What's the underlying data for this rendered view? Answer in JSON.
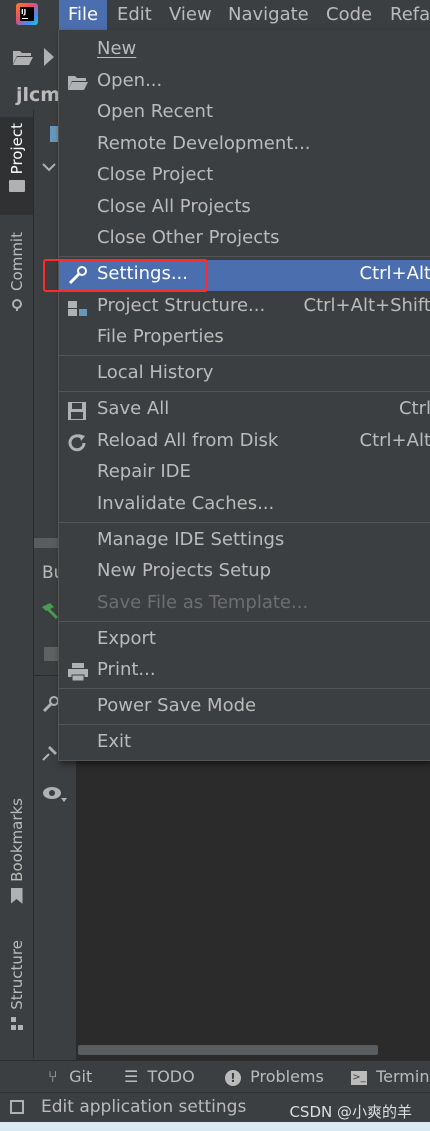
{
  "menubar": {
    "items": [
      "File",
      "Edit",
      "View",
      "Navigate",
      "Code",
      "Refac"
    ],
    "active": "File"
  },
  "project_name": "jlcm",
  "left_tabs": {
    "project": "Project",
    "commit": "Commit",
    "bookmarks": "Bookmarks",
    "structure": "Structure"
  },
  "tool_window_label": "Bu",
  "file_menu": {
    "items": [
      {
        "label": "New",
        "shortcut": ""
      },
      {
        "label": "Open...",
        "shortcut": ""
      },
      {
        "label": "Open Recent",
        "shortcut": ""
      },
      {
        "label": "Remote Development...",
        "shortcut": ""
      },
      {
        "label": "Close Project",
        "shortcut": ""
      },
      {
        "label": "Close All Projects",
        "shortcut": ""
      },
      {
        "label": "Close Other Projects",
        "shortcut": ""
      },
      {
        "label": "Settings...",
        "shortcut": "Ctrl+Alt"
      },
      {
        "label": "Project Structure...",
        "shortcut": "Ctrl+Alt+Shift"
      },
      {
        "label": "File Properties",
        "shortcut": ""
      },
      {
        "label": "Local History",
        "shortcut": ""
      },
      {
        "label": "Save All",
        "shortcut": "Ctrl"
      },
      {
        "label": "Reload All from Disk",
        "shortcut": "Ctrl+Alt"
      },
      {
        "label": "Repair IDE",
        "shortcut": ""
      },
      {
        "label": "Invalidate Caches...",
        "shortcut": ""
      },
      {
        "label": "Manage IDE Settings",
        "shortcut": ""
      },
      {
        "label": "New Projects Setup",
        "shortcut": ""
      },
      {
        "label": "Save File as Template...",
        "shortcut": ""
      },
      {
        "label": "Export",
        "shortcut": ""
      },
      {
        "label": "Print...",
        "shortcut": ""
      },
      {
        "label": "Power Save Mode",
        "shortcut": ""
      },
      {
        "label": "Exit",
        "shortcut": ""
      }
    ]
  },
  "bottom_tabs": {
    "git": "Git",
    "todo": "TODO",
    "problems": "Problems",
    "terminal": "Termin"
  },
  "statusbar": {
    "text": "Edit application settings",
    "watermark": "CSDN @小爽的羊"
  },
  "colors": {
    "background": "#3c3f41",
    "selection": "#4b6eaf",
    "highlight_box": "#ff2a2a"
  }
}
